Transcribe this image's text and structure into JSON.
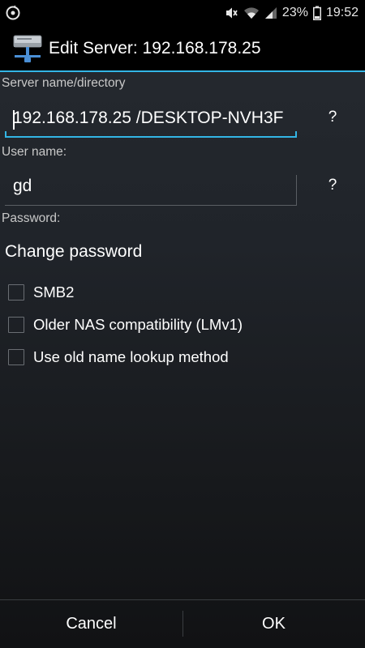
{
  "status_bar": {
    "battery_percent": "23%",
    "time": "19:52"
  },
  "dialog": {
    "title": "Edit Server: 192.168.178.25"
  },
  "form": {
    "server_label": "Server name/directory",
    "server_value": "192.168.178.25 /DESKTOP-NVH3F",
    "user_label": "User name:",
    "user_value": "gd",
    "help_label": "?",
    "password_label": "Password:",
    "change_password": "Change password",
    "options": [
      {
        "label": "SMB2",
        "checked": false
      },
      {
        "label": "Older NAS compatibility (LMv1)",
        "checked": false
      },
      {
        "label": "Use old name lookup method",
        "checked": false
      }
    ]
  },
  "buttons": {
    "cancel": "Cancel",
    "ok": "OK"
  },
  "colors": {
    "accent": "#33b5e5",
    "background": "#20242a"
  }
}
